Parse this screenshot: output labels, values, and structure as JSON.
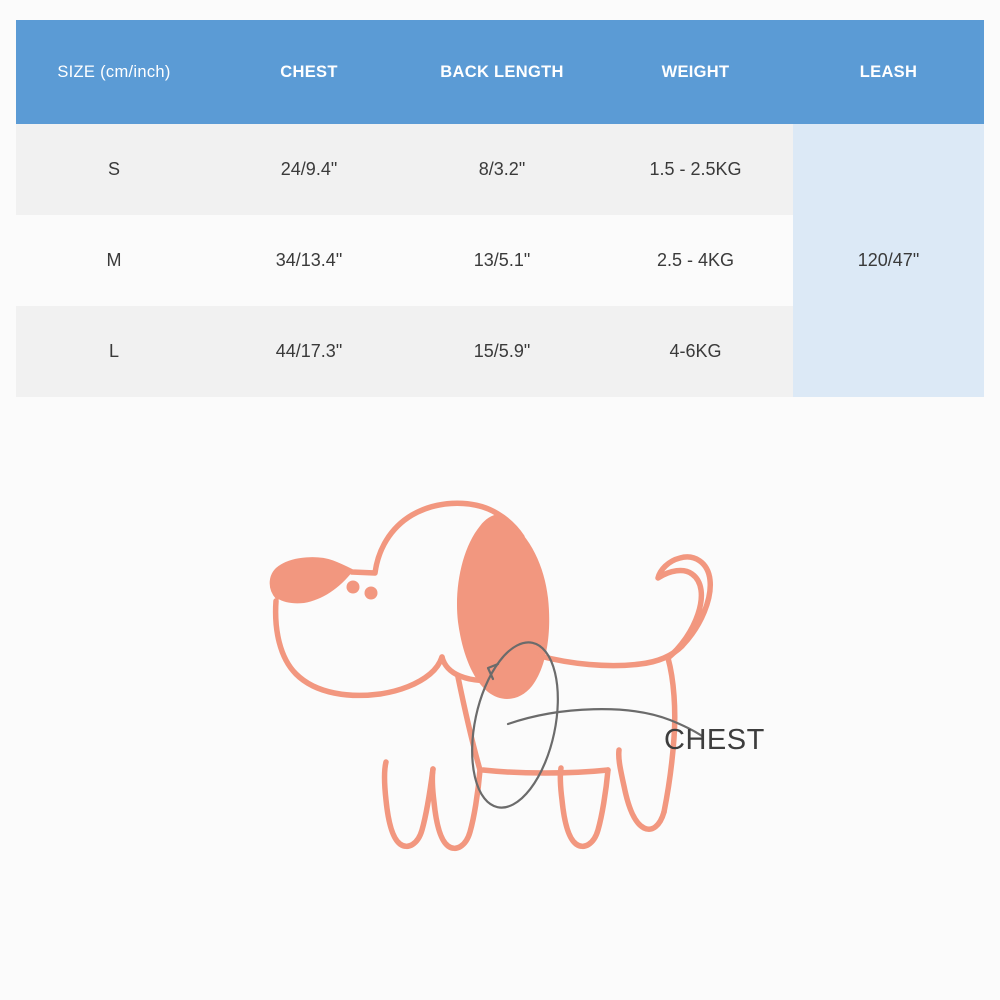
{
  "page": {
    "background_color": "#fbfbfb",
    "accent_blue": "#5b9bd5",
    "leash_cell_color": "#dce9f6",
    "row_odd_color": "#f1f1f1",
    "row_even_color": "#fbfbfb",
    "dog_color": "#f2977f",
    "annotation_color": "#6b6b6b"
  },
  "table": {
    "columns": [
      {
        "key": "size",
        "label": "SIZE (cm/inch)"
      },
      {
        "key": "chest",
        "label": "CHEST"
      },
      {
        "key": "back",
        "label": "BACK LENGTH"
      },
      {
        "key": "weight",
        "label": "WEIGHT"
      },
      {
        "key": "leash",
        "label": "LEASH"
      }
    ],
    "rows": [
      {
        "size": "S",
        "chest": "24/9.4\"",
        "back": "8/3.2\"",
        "weight": "1.5 - 2.5KG"
      },
      {
        "size": "M",
        "chest": "34/13.4\"",
        "back": "13/5.1\"",
        "weight": "2.5 - 4KG"
      },
      {
        "size": "L",
        "chest": "44/17.3\"",
        "back": "15/5.9\"",
        "weight": "4-6KG"
      }
    ],
    "leash_merged_value": "120/47\""
  },
  "illustration": {
    "chest_label": "CHEST",
    "subject": "dog-line-drawing"
  }
}
